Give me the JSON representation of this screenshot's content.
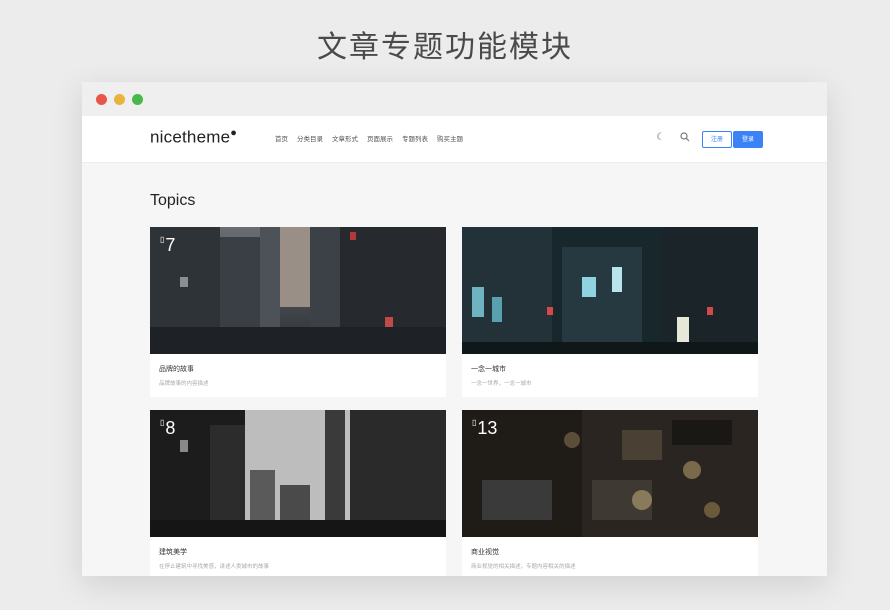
{
  "header": {
    "title": "文章专题功能模块"
  },
  "navbar": {
    "logo": "nicetheme",
    "logo_mark": "●",
    "links": [
      "首页",
      "分类目录",
      "文章形式",
      "页面展示",
      "专题列表",
      "购买主题"
    ],
    "login_label": "注册",
    "register_label": "登录",
    "icons": [
      "moon-icon",
      "search-icon"
    ]
  },
  "section": {
    "title": "Topics"
  },
  "topics": [
    {
      "count": "7",
      "name": "品牌的故事",
      "desc": "品牌故事的内容描述"
    },
    {
      "count": "",
      "name": "一念一城市",
      "desc": "一念一世界，一念一城市"
    },
    {
      "count": "8",
      "name": "建筑美学",
      "desc": "在停止建筑中寻找美感，讲述人类城市的故事"
    },
    {
      "count": "13",
      "name": "商业视觉",
      "desc": "商业视觉的相关描述，专题内容相关的描述"
    }
  ],
  "colors": {
    "accent": "#3b82f6"
  }
}
